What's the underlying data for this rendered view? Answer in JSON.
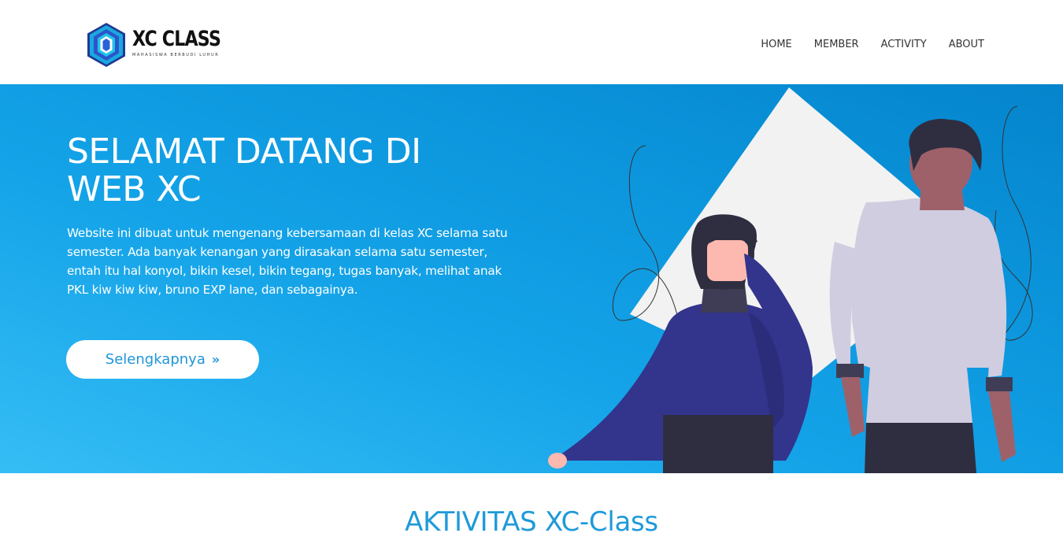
{
  "header": {
    "logo": {
      "text": "XC CLASS",
      "tagline": "MAHASISWA BERBUDI LUHUR",
      "icon": "hexagon-logo-icon"
    },
    "nav": [
      {
        "label": "HOME"
      },
      {
        "label": "MEMBER"
      },
      {
        "label": "ACTIVITY"
      },
      {
        "label": "ABOUT"
      }
    ]
  },
  "hero": {
    "title": "SELAMAT DATANG DI WEB XC",
    "description": "Website ini dibuat untuk mengenang kebersamaan di kelas XC selama satu semester. Ada banyak kenangan yang dirasakan selama satu semester, entah itu hal konyol, bikin kesel, bikin tegang, tugas banyak, melihat anak PKL kiw kiw kiw, bruno EXP lane, dan sebagainya.",
    "button_label": "Selengkapnya",
    "button_icon": "double-chevron-right-icon",
    "illustration": "two-people-illustration"
  },
  "section": {
    "title": "AKTIVITAS XC-Class"
  },
  "colors": {
    "hero_gradient_start": "#35bdf5",
    "hero_gradient_end": "#0584cc",
    "accent": "#1e9ad9",
    "nav_text": "#333333"
  }
}
